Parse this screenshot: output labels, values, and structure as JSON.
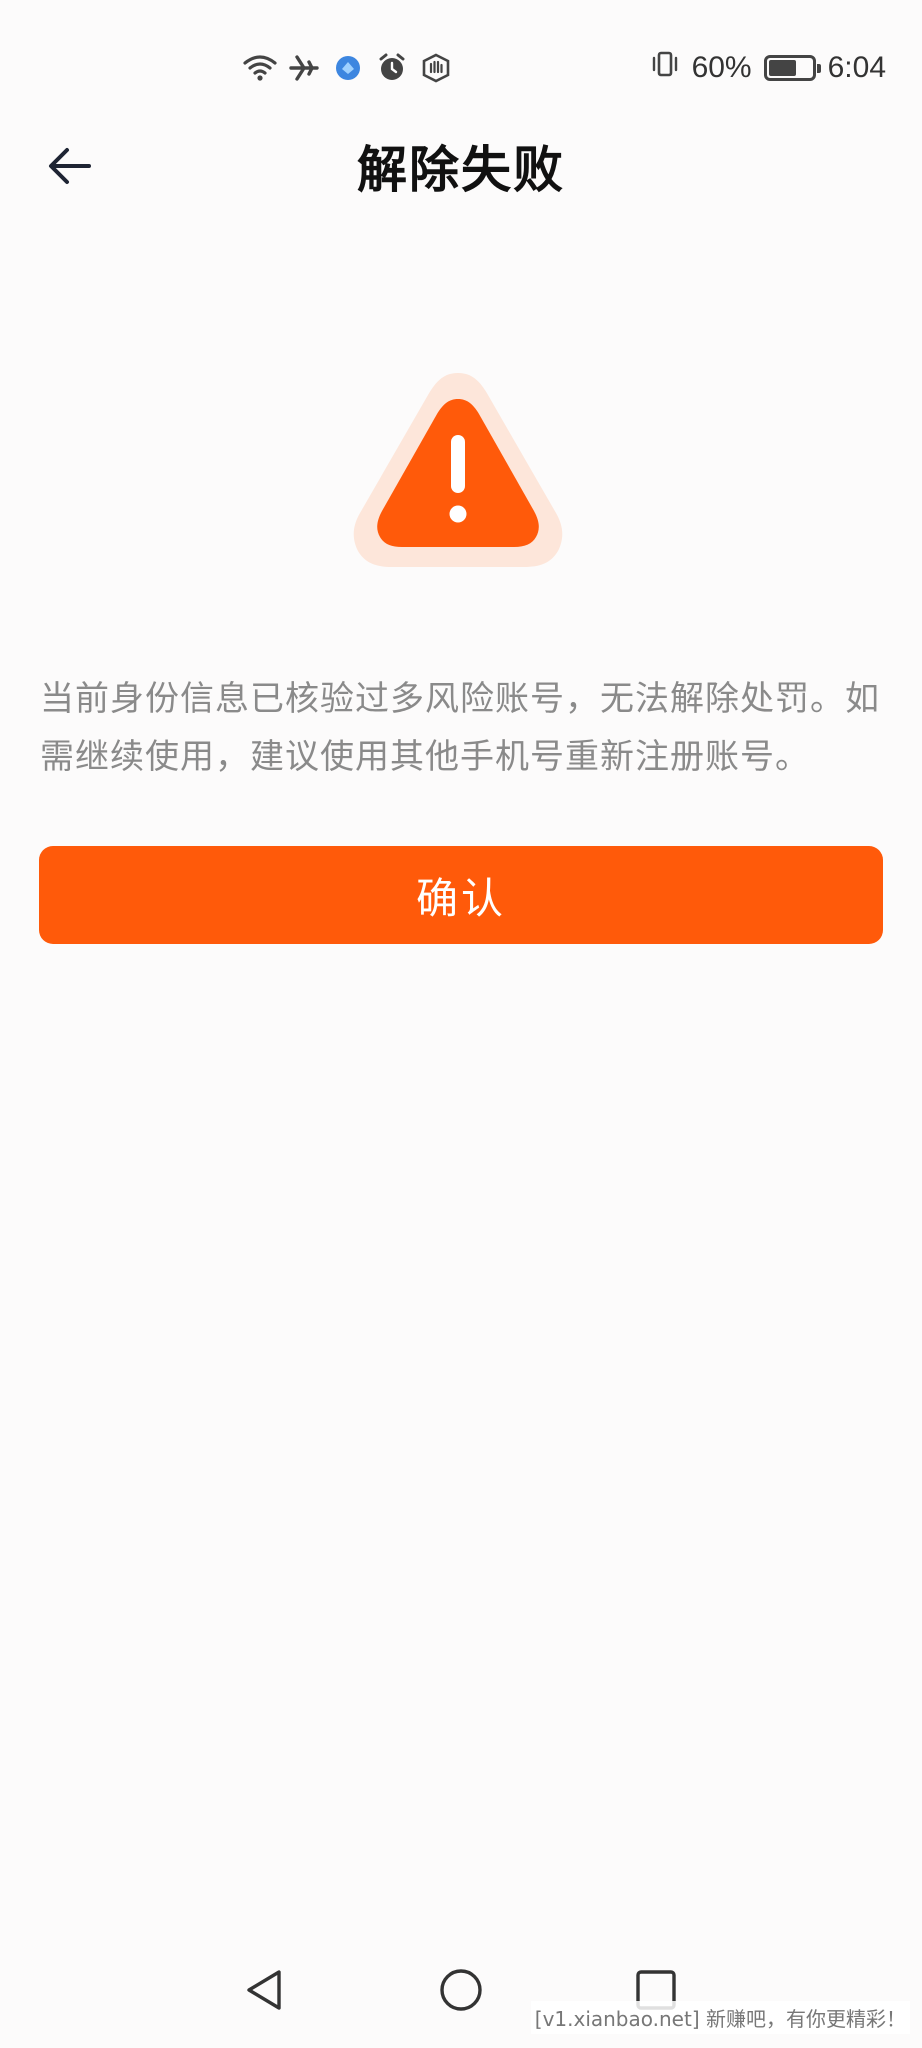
{
  "status_bar": {
    "battery_percent": "60%",
    "time": "6:04",
    "battery_level": 0.6,
    "icons": [
      "wifi-icon",
      "airplane-icon",
      "app-notification-icon",
      "alarm-icon",
      "hand-icon",
      "vibrate-icon",
      "battery-icon"
    ]
  },
  "header": {
    "back_icon": "back-arrow-icon",
    "title": "解除失败"
  },
  "main": {
    "warning_icon": "warning-triangle-icon",
    "message": "当前身份信息已核验过多风险账号，无法解除处罚。如需继续使用，建议使用其他手机号重新注册账号。",
    "confirm_label": "确认"
  },
  "system_nav": {
    "icons": [
      "back-triangle-icon",
      "home-circle-icon",
      "recents-square-icon"
    ]
  },
  "watermark": "[v1.xianbao.net] 新赚吧，有你更精彩！",
  "colors": {
    "accent": "#ff5a0a",
    "warning_halo": "#fde6da",
    "background": "#fcfbfb",
    "message_text": "#8a8a8a"
  }
}
